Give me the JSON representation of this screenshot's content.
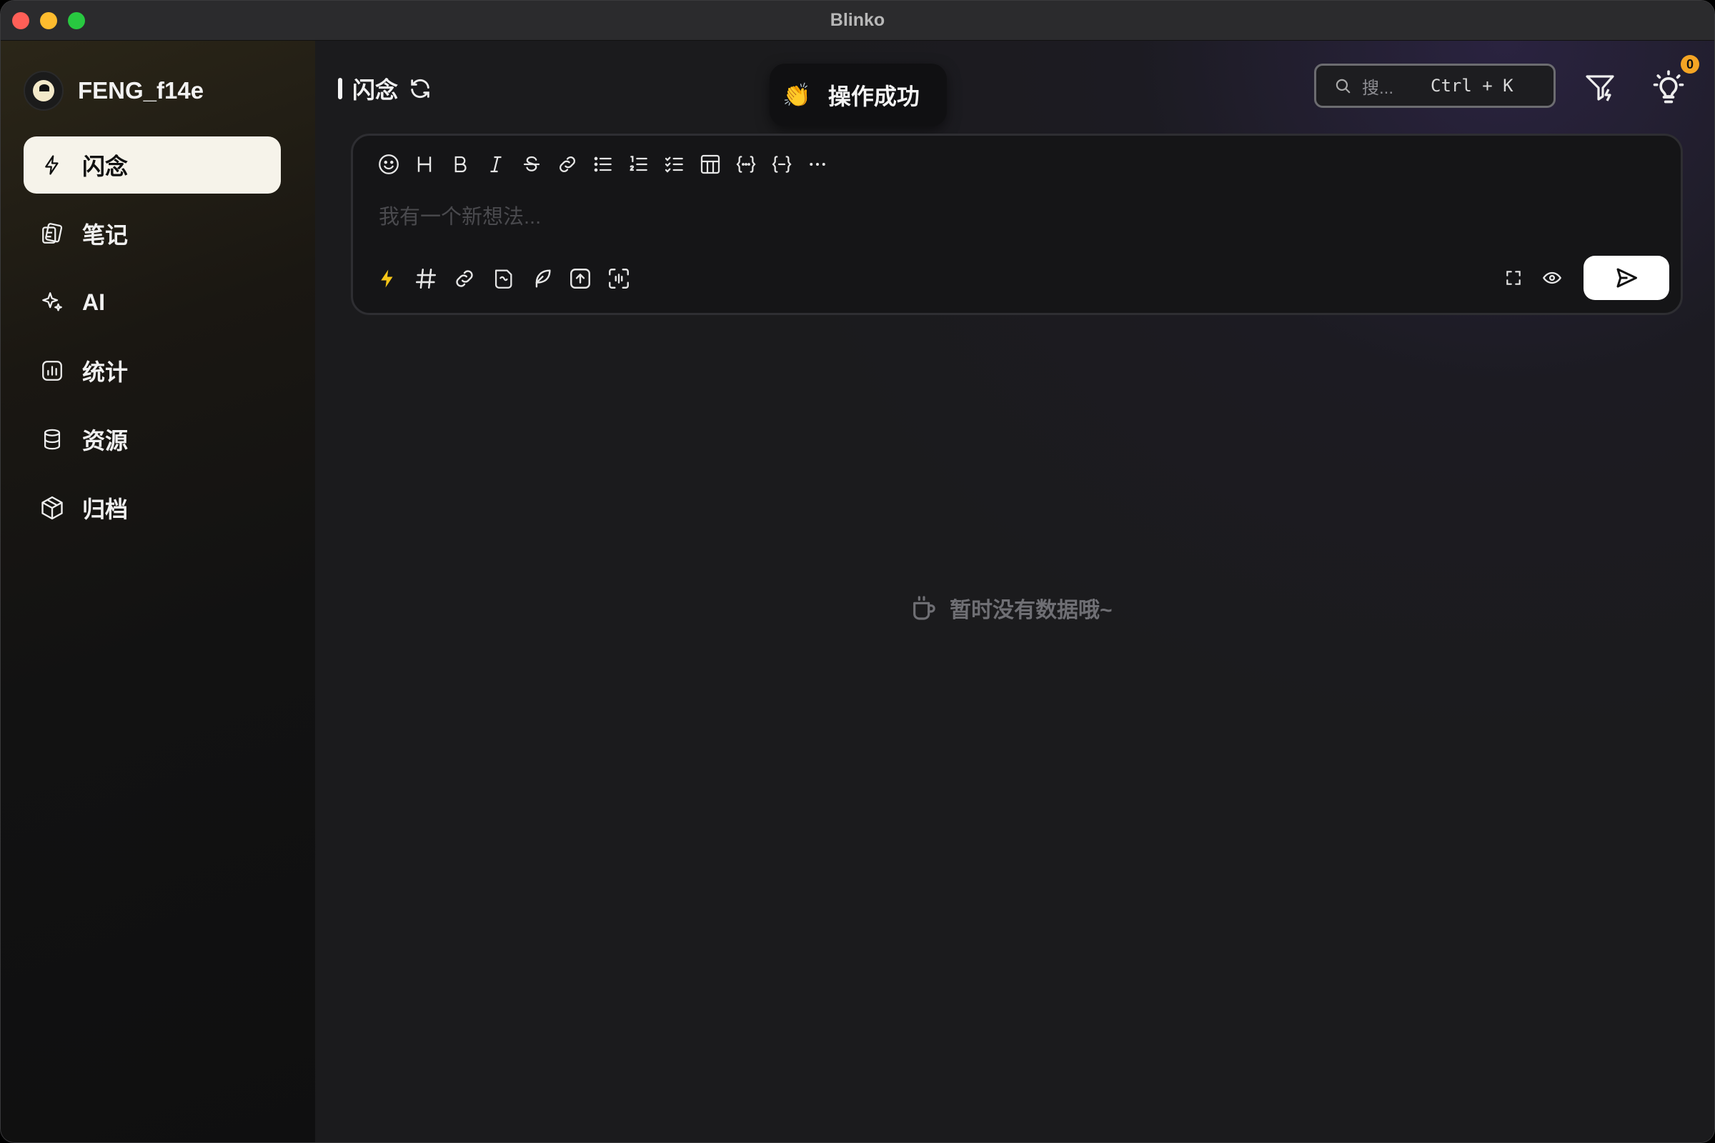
{
  "window": {
    "title": "Blinko"
  },
  "sidebar": {
    "username": "FENG_f14e",
    "items": [
      {
        "label": "闪念",
        "icon": "bolt-icon",
        "active": true
      },
      {
        "label": "笔记",
        "icon": "notes-icon",
        "active": false
      },
      {
        "label": "AI",
        "icon": "sparkle-icon",
        "active": false
      },
      {
        "label": "统计",
        "icon": "stats-icon",
        "active": false
      },
      {
        "label": "资源",
        "icon": "database-icon",
        "active": false
      },
      {
        "label": "归档",
        "icon": "archive-box-icon",
        "active": false
      }
    ]
  },
  "header": {
    "title": "闪念"
  },
  "toast": {
    "emoji": "👏",
    "message": "操作成功"
  },
  "search": {
    "placeholder": "搜...",
    "shortcut": "Ctrl + K"
  },
  "notifications": {
    "count": "0"
  },
  "editor": {
    "placeholder": "我有一个新想法...",
    "toolbar": [
      "emoji",
      "heading",
      "bold",
      "italic",
      "strikethrough",
      "link",
      "bullet-list",
      "ordered-list",
      "task-list",
      "table",
      "code-inline",
      "code-block",
      "more"
    ]
  },
  "empty_state": {
    "message": "暂时没有数据哦~"
  },
  "colors": {
    "accent": "#f5c518",
    "active_nav_bg": "#f6f3ea",
    "badge": "#f5a524"
  }
}
